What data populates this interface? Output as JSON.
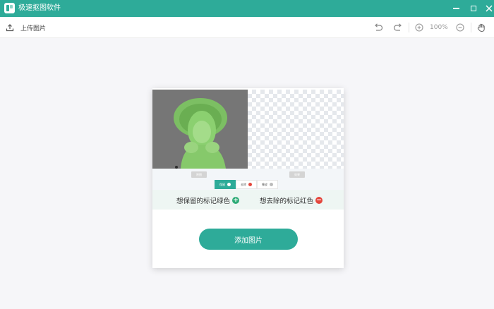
{
  "window": {
    "title": "极速抠图软件",
    "accent_color": "#2eab99"
  },
  "toolbar": {
    "upload_label": "上传图片",
    "zoom_level": "100%",
    "icons": [
      "upload-icon",
      "undo-icon",
      "redo-icon",
      "zoom-in-icon",
      "zoom-out-icon",
      "hand-icon"
    ]
  },
  "sample": {
    "left_tag": "原图",
    "right_tag": "效果",
    "tabs": [
      {
        "label": "保留",
        "active": true
      },
      {
        "label": "去除",
        "active": false
      },
      {
        "label": "橡皮",
        "active": false
      }
    ]
  },
  "legend": {
    "keep_label": "想保留的标记绿色",
    "keep_icon": "plus-circle-green-icon",
    "remove_label": "想去除的标记红色",
    "remove_icon": "minus-circle-red-icon"
  },
  "main": {
    "add_image_label": "添加图片"
  }
}
